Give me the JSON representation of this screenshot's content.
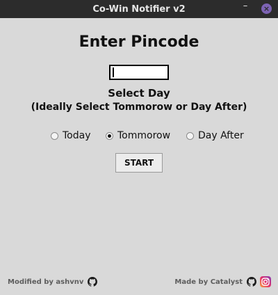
{
  "window": {
    "title": "Co-Win Notifier v2"
  },
  "main": {
    "heading": "Enter Pincode",
    "pincode": {
      "value": ""
    },
    "select_title": "Select Day",
    "select_hint": "(Ideally Select Tommorow or Day After)",
    "options": [
      {
        "label": "Today",
        "checked": false
      },
      {
        "label": "Tommorow",
        "checked": true
      },
      {
        "label": "Day After",
        "checked": false
      }
    ],
    "start_label": "START"
  },
  "footer": {
    "left_text": "Modified by ashvnv",
    "right_text": "Made by Catalyst",
    "icons": [
      "github-icon",
      "github-icon",
      "instagram-icon"
    ]
  },
  "colors": {
    "titlebar": "#2c2c2c",
    "background": "#d9d9d9",
    "close_button": "#7d63b4",
    "footer_text": "#5d5d5d"
  }
}
